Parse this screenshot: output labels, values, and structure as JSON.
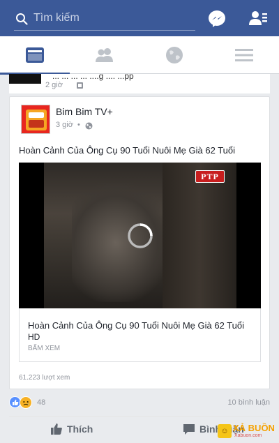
{
  "search": {
    "placeholder": "Tìm kiếm"
  },
  "colors": {
    "brand": "#3b5998",
    "like": "#5890ff",
    "sad": "#f7b125"
  },
  "icons": {
    "top_right": [
      "messenger-icon",
      "friend-requests-icon"
    ],
    "tabs": [
      "news-feed-icon",
      "friends-icon",
      "notifications-globe-icon",
      "menu-icon"
    ]
  },
  "previous_post": {
    "name": "... ... ... ... ....g .... ...pp",
    "time": "2 giờ"
  },
  "post": {
    "page_name": "Bim Bim TV+",
    "time": "3 giờ",
    "dot": "•",
    "text": "Hoàn Cảnh Của Ông Cụ 90 Tuổi Nuôi Mẹ Già 62 Tuổi",
    "video_logo": "PTP",
    "link": {
      "title": "Hoàn Cảnh Của Ông Cụ 90 Tuổi Nuôi Mẹ Già 62 Tuổi",
      "subtitle": "HD",
      "cta": "BẤM XEM"
    },
    "views": "61.223 lượt xem",
    "reaction_count": "48",
    "comment_count": "10 bình luận"
  },
  "actions": {
    "like": "Thích",
    "comment": "Bình luận"
  },
  "watermark": {
    "brand": "XẢ BUỒN",
    "site": "Xabuon.com"
  }
}
